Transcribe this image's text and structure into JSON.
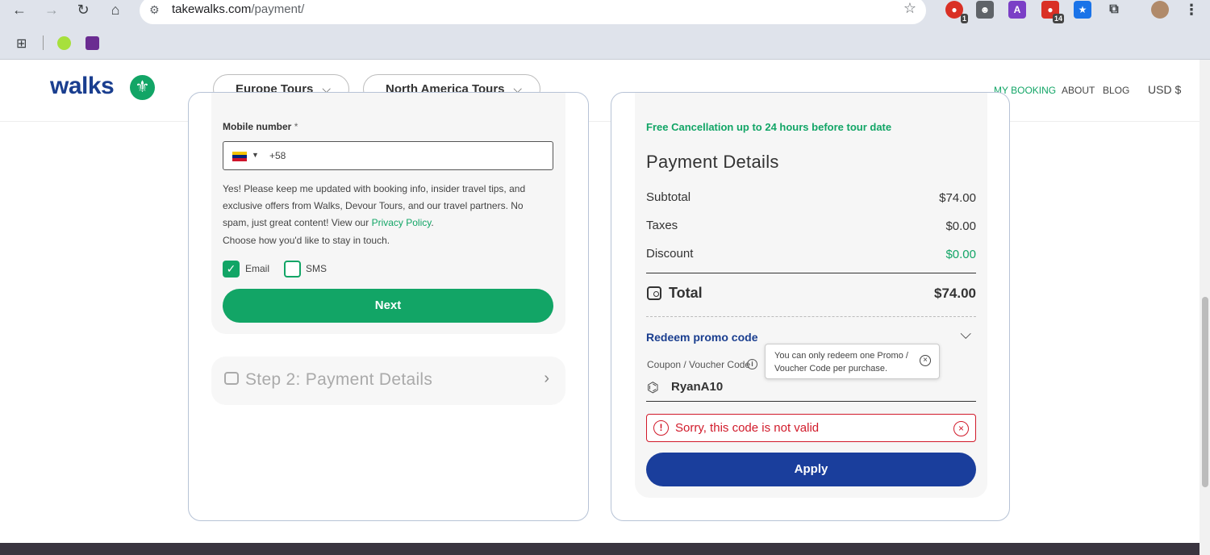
{
  "browser": {
    "url_host": "takewalks.com",
    "url_path": "/payment/",
    "extension_badges": [
      "1",
      "14"
    ]
  },
  "header": {
    "logo": "walks",
    "nav_pills": [
      "Europe Tours",
      "North America Tours"
    ],
    "links": [
      "MY BOOKING",
      "ABOUT",
      "BLOG"
    ],
    "currency": "USD $"
  },
  "contact": {
    "mobile_label": "Mobile number",
    "required_mark": "*",
    "phone_prefix": "+58",
    "consent_text": "Yes! Please keep me updated with booking info, insider travel tips, and exclusive offers from Walks, Devour Tours, and our travel partners. No spam, just great content! View our",
    "privacy_link": "Privacy Policy",
    "consent_end": ".",
    "choose_text": "Choose how you'd like to stay in touch.",
    "email_label": "Email",
    "email_checked": true,
    "sms_label": "SMS",
    "sms_checked": false,
    "next_label": "Next"
  },
  "step2": {
    "title": "Step 2: Payment Details"
  },
  "payment": {
    "free_cancellation": "Free Cancellation up to 24 hours before tour date",
    "title": "Payment Details",
    "subtotal_label": "Subtotal",
    "subtotal": "$74.00",
    "taxes_label": "Taxes",
    "taxes": "$0.00",
    "discount_label": "Discount",
    "discount": "$0.00",
    "total_label": "Total",
    "total": "$74.00",
    "redeem_label": "Redeem promo code",
    "coupon_label": "Coupon / Voucher Code",
    "coupon_value": "RyanA10",
    "tooltip": "You can only redeem one Promo / Voucher Code per purchase.",
    "error": "Sorry, this code is not valid",
    "apply_label": "Apply"
  },
  "colors": {
    "brand_green": "#12a566",
    "brand_blue": "#1a3e9c",
    "error_red": "#d11a2a"
  }
}
